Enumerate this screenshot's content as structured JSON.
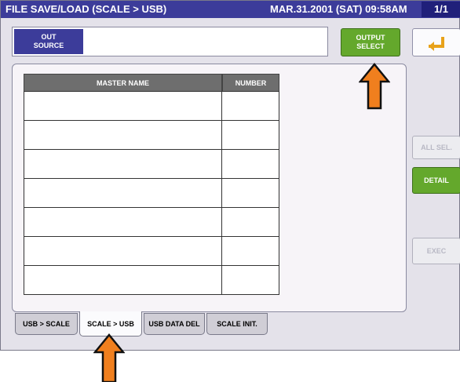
{
  "header": {
    "title": "FILE SAVE/LOAD (SCALE > USB)",
    "datetime": "MAR.31.2001 (SAT) 09:58AM",
    "page": "1/1"
  },
  "source": {
    "label": "OUT\nSOURCE",
    "value": ""
  },
  "buttons": {
    "output_select": "OUTPUT\nSELECT",
    "all_sel": "ALL SEL.",
    "detail": "DETAIL",
    "exec": "EXEC"
  },
  "table": {
    "columns": [
      "MASTER NAME",
      "NUMBER"
    ],
    "rows": [
      [
        "",
        ""
      ],
      [
        "",
        ""
      ],
      [
        "",
        ""
      ],
      [
        "",
        ""
      ],
      [
        "",
        ""
      ],
      [
        "",
        ""
      ],
      [
        "",
        ""
      ]
    ]
  },
  "tabs": [
    {
      "label": "USB > SCALE"
    },
    {
      "label": "SCALE > USB"
    },
    {
      "label": "USB DATA DEL"
    },
    {
      "label": "SCALE INIT."
    }
  ],
  "colors": {
    "title_bar": "#3c3c9a",
    "green_button": "#64a82c",
    "arrow": "#f07f1e"
  }
}
